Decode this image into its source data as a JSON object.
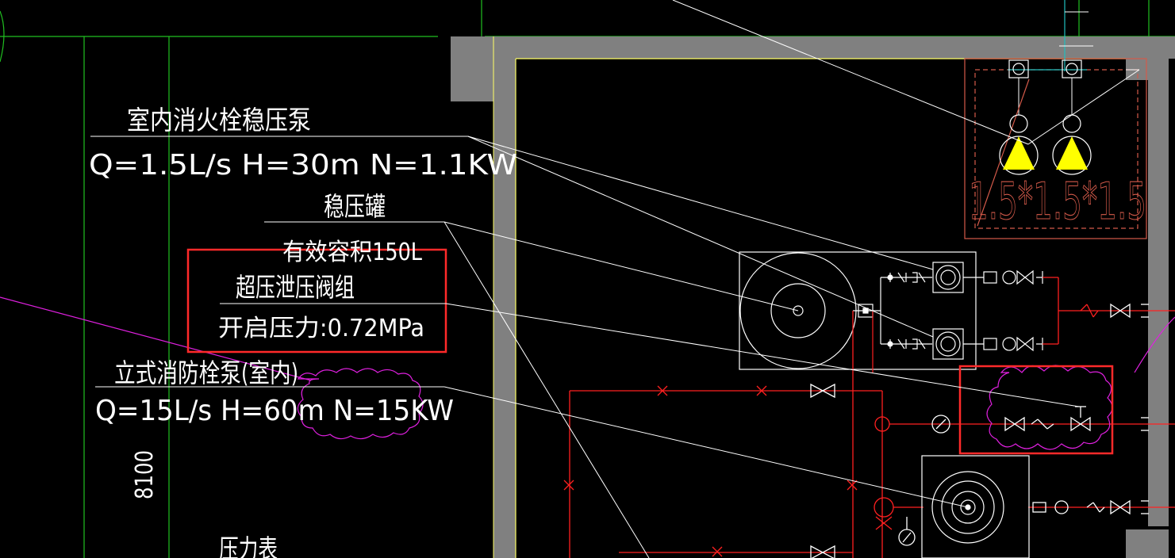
{
  "labels": {
    "booster_pump_title": "室内消火栓稳压泵",
    "booster_pump_spec": "Q=1.5L/s H=30m N=1.1KW",
    "pressure_tank_title": "稳压罐",
    "pressure_tank_spec": "有效容积150L",
    "relief_valve_title": "超压泄压阀组",
    "relief_valve_spec": "开启压力:0.72MPa",
    "vertical_pump_title": "立式消防栓泵(室内)",
    "vertical_pump_spec": "Q=15L/s H=60m N=15KW",
    "dimension_8100": "8100",
    "pressure_gauge": "压力表",
    "pit_size": "1.5*1.5*1.5"
  },
  "colors": {
    "background": "#000000",
    "leader_lines": "#ffffff",
    "wall_fill": "#808080",
    "wall_edge": "#ffff66",
    "pipe_red": "#ff2020",
    "highlight_box": "#ff2a2a",
    "revision_cloud": "#e020e0",
    "axis_green": "#20c020",
    "pump_marker": "#ffff00",
    "pit_outline": "#d45a4a",
    "cyan_line": "#20c0c0"
  }
}
